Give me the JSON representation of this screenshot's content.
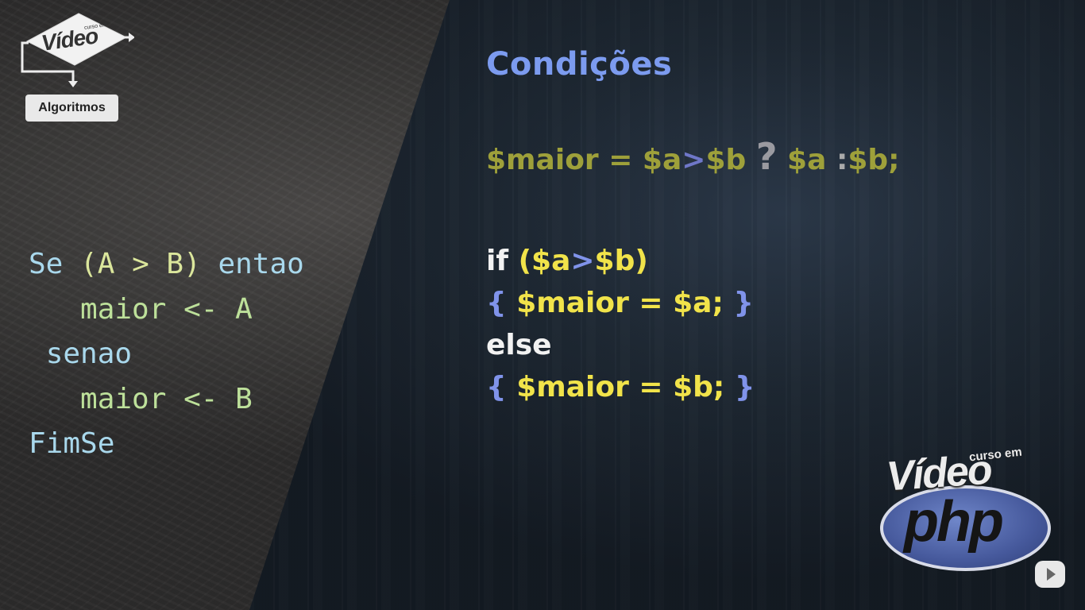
{
  "branding": {
    "algo_curso": "curso em",
    "algo_video": "Vídeo",
    "algo_label": "Algoritmos",
    "php_curso": "curso em",
    "php_video": "Vídeo",
    "php_word": "php"
  },
  "pseudocode": {
    "line1_kw": "Se",
    "line1_cond": "(A > B)",
    "line1_kw2": "entao",
    "line2": "maior <- A",
    "line3": "senao",
    "line4": "maior <- B",
    "line5": "FimSe"
  },
  "slide": {
    "title": "Condições",
    "ternary": {
      "lhs": "$maior = $a",
      "gt": ">",
      "rhs_b": "$b",
      "question": "?",
      "then": "$a",
      "colon": ":",
      "else": "$b;"
    },
    "code": {
      "if_kw": "if",
      "if_cond_open": "($a",
      "if_gt": ">",
      "if_cond_close": "$b)",
      "brace_open_1": "{",
      "stmt_1": "$maior = $a;",
      "brace_close_1": "}",
      "else_kw": "else",
      "brace_open_2": "{",
      "stmt_2": "$maior = $b;",
      "brace_close_2": "}"
    }
  },
  "colors": {
    "title": "#7c9bef",
    "code_yellow": "#f1e34a",
    "code_blue": "#8093ea",
    "ternary_olive": "#9ea03a"
  },
  "icons": {
    "youtube": "youtube-icon"
  }
}
